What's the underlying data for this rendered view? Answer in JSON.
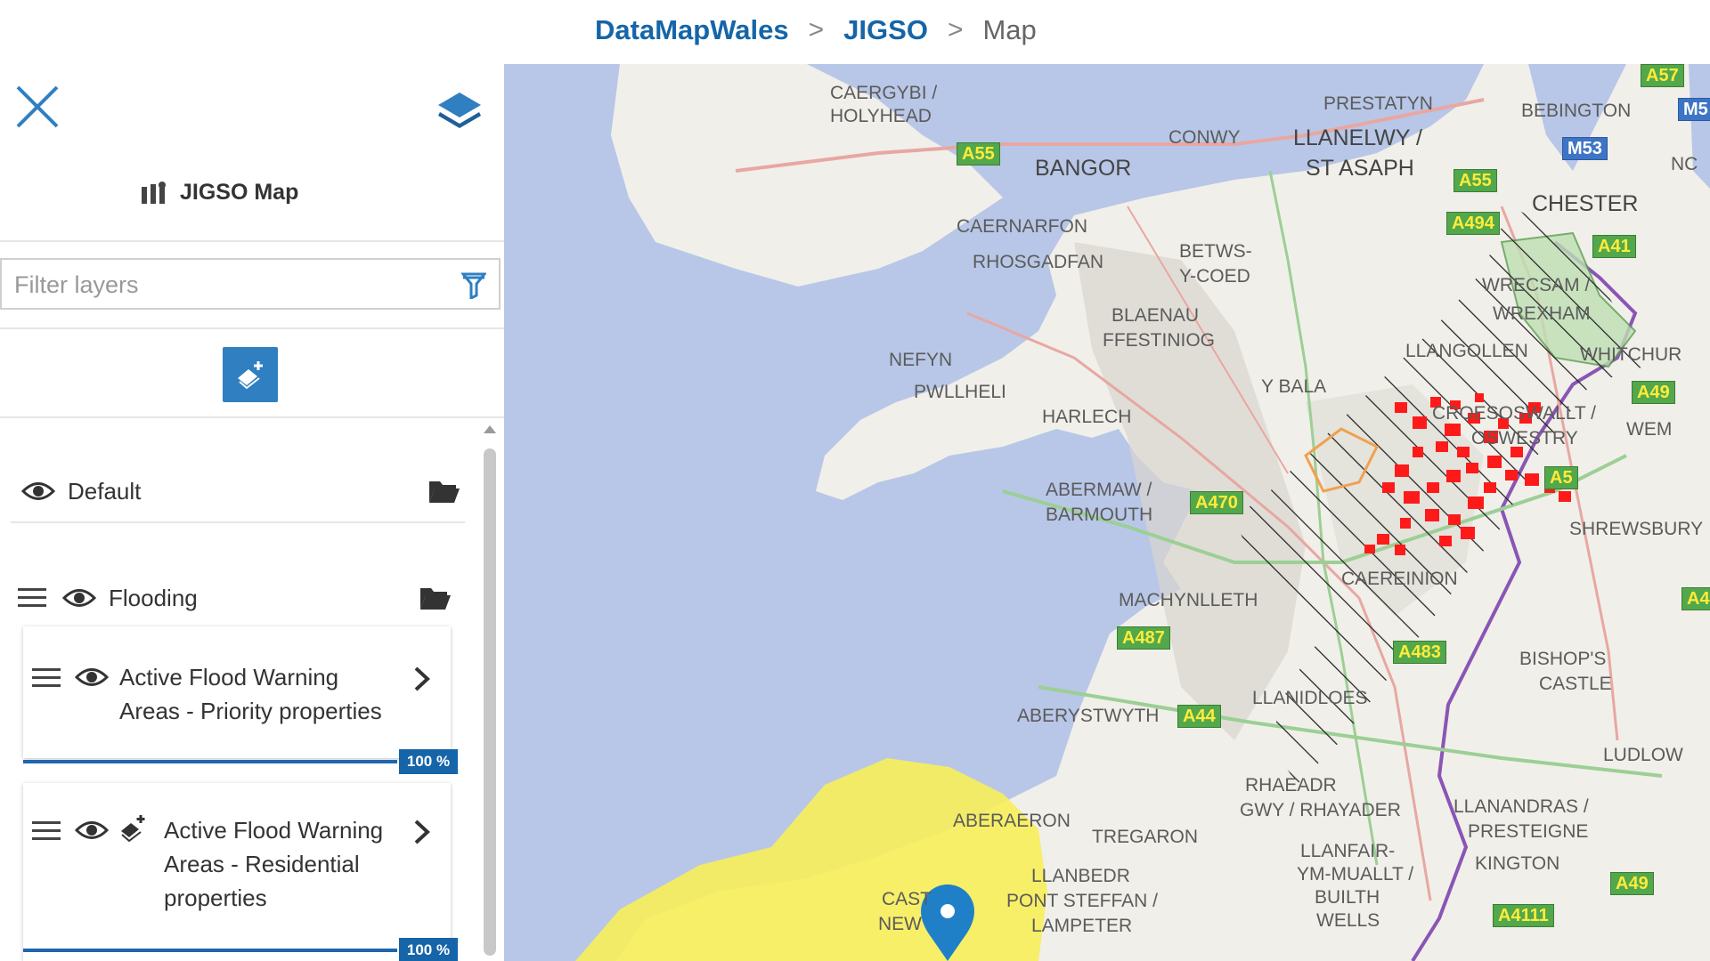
{
  "breadcrumb": {
    "root": "DataMapWales",
    "section": "JIGSO",
    "current": "Map",
    "separator": ">"
  },
  "sidebar": {
    "title": "JIGSO Map",
    "filter": {
      "placeholder": "Filter layers",
      "value": ""
    },
    "groups": [
      {
        "label": "Default"
      },
      {
        "label": "Flooding"
      }
    ],
    "layers": [
      {
        "line1": "Active Flood Warning",
        "line2": "Areas - Priority properties",
        "line3": "",
        "opacity": 100,
        "opacity_label": "100 %"
      },
      {
        "line1": "Active Flood Warning",
        "line2": "Areas - Residential",
        "line3": "properties",
        "opacity": 100,
        "opacity_label": "100 %"
      }
    ]
  },
  "map": {
    "places": [
      "CAERGYBI /",
      "HOLYHEAD",
      "BANGOR",
      "CONWY",
      "PRESTATYN",
      "LLANELWY /",
      "ST ASAPH",
      "BEBINGTON",
      "CHESTER",
      "CAERNARFON",
      "RHOSGADFAN",
      "BETWS-",
      "Y-COED",
      "BLAENAU",
      "FFESTINIOG",
      "WRECSAM /",
      "WREXHAM",
      "NEFYN",
      "PWLLHELI",
      "LLANGOLLEN",
      "WHITCHUR",
      "Y BALA",
      "HARLECH",
      "CROESOSWALLT /",
      "OSWESTRY",
      "WEM",
      "ABERMAW /",
      "BARMOUTH",
      "SHREWSBURY",
      "MACHYNLLETH",
      "CAEREINION",
      "BISHOP'S",
      "CASTLE",
      "ABERYSTWYTH",
      "LLANIDLOES",
      "LUDLOW",
      "RHAEADR",
      "GWY / RHAYADER",
      "LLANANDRAS /",
      "PRESTEIGNE",
      "ABERAERON",
      "TREGARON",
      "LLANFAIR-",
      "YM-MUALLT /",
      "BUILTH",
      "WELLS",
      "KINGTON",
      "LLANBEDR",
      "PONT STEFFAN /",
      "LAMPETER",
      "CAST",
      "NEW",
      "NC"
    ],
    "roads": [
      "A55",
      "A55",
      "A494",
      "A41",
      "A49",
      "A5",
      "A470",
      "A487",
      "A483",
      "A44",
      "A49",
      "A4111",
      "M53",
      "A57",
      "M5",
      "A4"
    ],
    "colors": {
      "sea": "#b8c7e7",
      "land": "#f1efe9",
      "flood_fill": "#f7ee5a",
      "priority": "#ff1a1a",
      "accent": "#1565a8"
    }
  },
  "icons": {
    "close": "close-icon",
    "layers": "layers-stack-icon",
    "map": "map-icon",
    "filter": "filter-icon",
    "add": "add-layer-icon",
    "eye": "eye-icon",
    "folder": "folder-open-icon",
    "drag": "drag-handle-icon",
    "chevron": "chevron-right-icon",
    "marker": "map-marker-icon"
  }
}
